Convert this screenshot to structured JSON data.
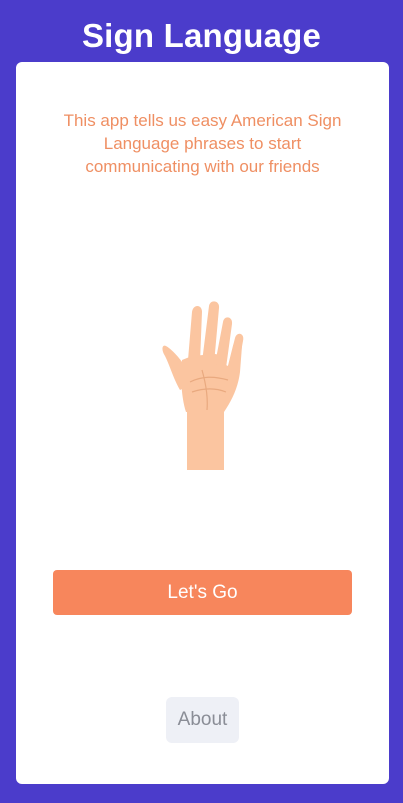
{
  "header": {
    "title": "Sign Language"
  },
  "main": {
    "intro_text": "This app tells us easy American Sign Language phrases to start communicating with our friends",
    "illustration": "raised-hand-icon",
    "primary_button_label": "Let's Go",
    "secondary_button_label": "About"
  },
  "colors": {
    "background": "#4b3ccb",
    "card": "#ffffff",
    "accent": "#f7865c",
    "intro_text": "#ef8f63",
    "secondary_button_bg": "#eef0f6",
    "skin": "#fbc5a0"
  }
}
